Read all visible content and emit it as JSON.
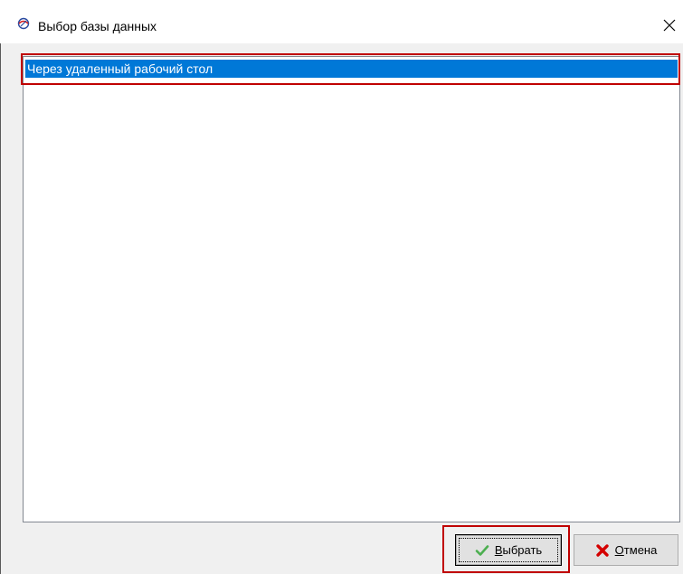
{
  "window": {
    "title": "Выбор базы данных",
    "title_icon": "app-logo-icon",
    "close_icon": "close-icon"
  },
  "list": {
    "items": [
      {
        "label": "Через удаленный рабочий стол",
        "selected": true
      }
    ]
  },
  "buttons": {
    "select": {
      "mnemonic": "В",
      "rest": "ыбрать",
      "icon": "checkmark-icon"
    },
    "cancel": {
      "mnemonic": "О",
      "rest": "тмена",
      "icon": "cross-icon"
    }
  },
  "colors": {
    "selection": "#0078d7",
    "annotation_highlight": "#c00000",
    "checkmark": "#4caf50",
    "cross": "#d40000"
  }
}
